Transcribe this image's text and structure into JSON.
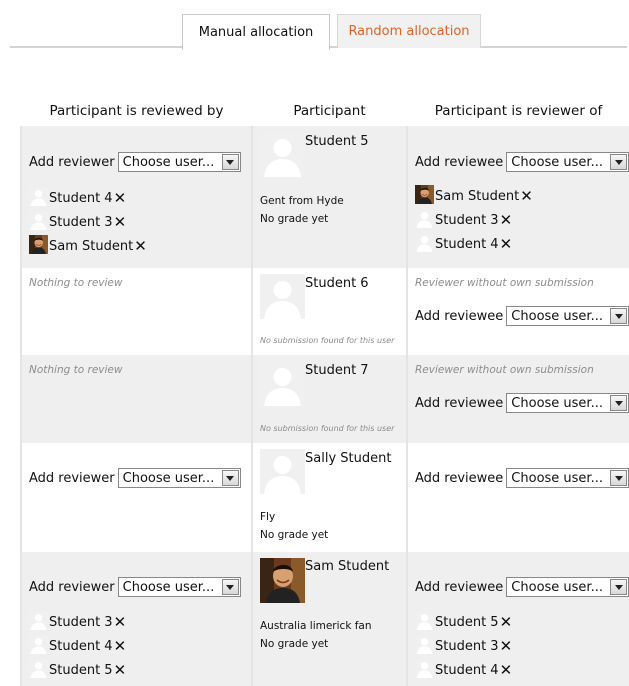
{
  "tabs": {
    "manual": "Manual allocation",
    "random": "Random allocation"
  },
  "headers": {
    "reviewed_by": "Participant is reviewed by",
    "participant": "Participant",
    "reviewer_of": "Participant is reviewer of"
  },
  "labels": {
    "add_reviewer": "Add reviewer",
    "add_reviewee": "Add reviewee",
    "choose_user": "Choose user...",
    "remove": "✕"
  },
  "colors": {
    "tab_inactive_text": "#e2632a",
    "row_alt": "#efefef",
    "note_gray": "#8c8c8c"
  },
  "rows": [
    {
      "reviewed_by": [
        "Student 4",
        "Student 3",
        "Sam Student"
      ],
      "participant": {
        "name": "Student 5",
        "line1": "Gent from Hyde",
        "line2": "No grade yet"
      },
      "reviewer_of": [
        "Sam Student",
        "Student 3",
        "Student 4"
      ]
    },
    {
      "reviewed_by_note": "Nothing to review",
      "participant": {
        "name": "Student 6",
        "note": "No submission found for this user"
      },
      "reviewer_of_note": "Reviewer without own submission"
    },
    {
      "reviewed_by_note": "Nothing to review",
      "participant": {
        "name": "Student 7",
        "note": "No submission found for this user"
      },
      "reviewer_of_note": "Reviewer without own submission"
    },
    {
      "participant": {
        "name": "Sally Student",
        "line1": "Fly",
        "line2": "No grade yet"
      }
    },
    {
      "reviewed_by": [
        "Student 3",
        "Student 4",
        "Student 5"
      ],
      "participant": {
        "name": "Sam Student",
        "line1": "Australia limerick fan",
        "line2": "No grade yet"
      },
      "reviewer_of": [
        "Student 5",
        "Student 3",
        "Student 4"
      ]
    }
  ]
}
